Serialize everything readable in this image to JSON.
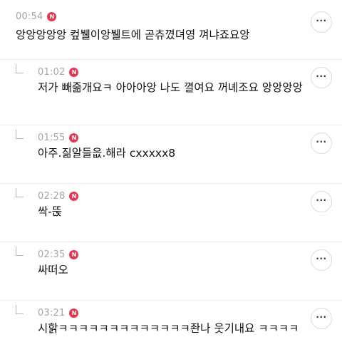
{
  "comments": [
    {
      "time": "00:54",
      "badge": "N",
      "text": "앙앙앙앙앙 컾뷀이앙뷀트에 곧츄꼈뎌영 껴냐죠요앙",
      "icon": "more-icon",
      "more": "···"
    },
    {
      "time": "01:02",
      "badge": "N",
      "text": "저가 빼줆개요ㅋ 아아아앙 나도 껼여요 꺼녜조요 앙앙앙앙",
      "icon": "more-icon",
      "more": "···"
    },
    {
      "time": "01:55",
      "badge": "N",
      "text": "아주.짊알들읎.해라 cxxxxx8",
      "icon": "more-icon",
      "more": "···"
    },
    {
      "time": "02:28",
      "badge": "N",
      "text": "싹-뚡",
      "icon": "more-icon",
      "more": "···"
    },
    {
      "time": "02:35",
      "badge": "N",
      "text": "싸떠오",
      "icon": "more-icon",
      "more": "···"
    },
    {
      "time": "03:21",
      "badge": "N",
      "text": "시핡ㅋㅋㅋㅋㅋㅋㅋㅋㅋㅋㅋㅋㅋ좐나 웃기내요 ㅋㅋㅋㅋㅋ",
      "icon": "more-icon",
      "more": "···"
    }
  ],
  "colors": {
    "badge": "#e8344e",
    "time": "#a6a6a6",
    "text": "#111111",
    "divider": "#ececec"
  }
}
